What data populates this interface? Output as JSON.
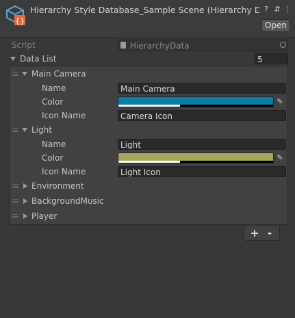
{
  "header": {
    "title": "Hierarchy Style Database_Sample Scene (Hierarchy D",
    "open_label": "Open",
    "icons": [
      "help-icon",
      "settings-sliders-icon",
      "more-menu-icon"
    ]
  },
  "script_row": {
    "label": "Script",
    "value": "HierarchyData"
  },
  "data_list": {
    "label": "Data List",
    "count": "5",
    "items": [
      {
        "title": "Main Camera",
        "expanded": true,
        "fields": {
          "name_label": "Name",
          "name_value": "Main Camera",
          "color_label": "Color",
          "color_hex": "#0b7ba7",
          "alpha": 0.4,
          "icon_label": "Icon Name",
          "icon_value": "Camera Icon"
        }
      },
      {
        "title": "Light",
        "expanded": true,
        "fields": {
          "name_label": "Name",
          "name_value": "Light",
          "color_label": "Color",
          "color_hex": "#a8a65a",
          "alpha": 0.4,
          "icon_label": "Icon Name",
          "icon_value": "Light Icon"
        }
      },
      {
        "title": "Environment",
        "expanded": false
      },
      {
        "title": "BackgroundMusic",
        "expanded": false
      },
      {
        "title": "Player",
        "expanded": false
      }
    ],
    "add_label": "+",
    "remove_label": "-"
  }
}
